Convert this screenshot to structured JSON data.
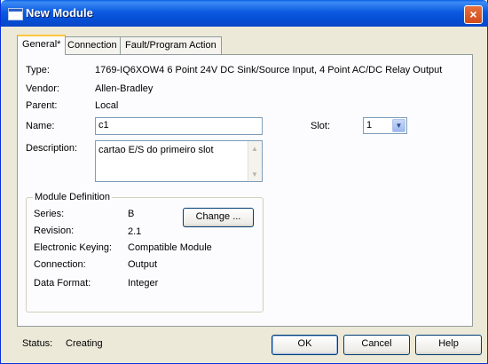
{
  "window": {
    "title": "New Module",
    "close_label": "×"
  },
  "tabs": [
    {
      "label": "General*",
      "active": true
    },
    {
      "label": "Connection",
      "active": false
    },
    {
      "label": "Fault/Program Action",
      "active": false
    }
  ],
  "general": {
    "type_label": "Type:",
    "type_value": "1769-IQ6XOW4 6 Point 24V DC Sink/Source Input, 4 Point AC/DC Relay Output",
    "vendor_label": "Vendor:",
    "vendor_value": "Allen-Bradley",
    "parent_label": "Parent:",
    "parent_value": "Local",
    "name_label": "Name:",
    "name_value": "c1",
    "slot_label": "Slot:",
    "slot_value": "1",
    "description_label": "Description:",
    "description_value": "cartao E/S do primeiro slot"
  },
  "module_definition": {
    "legend": "Module Definition",
    "series_label": "Series:",
    "series_value": "B",
    "revision_label": "Revision:",
    "revision_value": "2.1",
    "keying_label": "Electronic Keying:",
    "keying_value": "Compatible Module",
    "connection_label": "Connection:",
    "connection_value": "Output",
    "data_format_label": "Data Format:",
    "data_format_value": "Integer",
    "change_button": "Change ..."
  },
  "footer": {
    "status_label": "Status:",
    "status_value": "Creating",
    "ok_button": "OK",
    "cancel_button": "Cancel",
    "help_button": "Help"
  },
  "colors": {
    "titlebar": "#0450d6",
    "dialog_background": "#ece9d8",
    "input_border": "#7f9db9"
  }
}
